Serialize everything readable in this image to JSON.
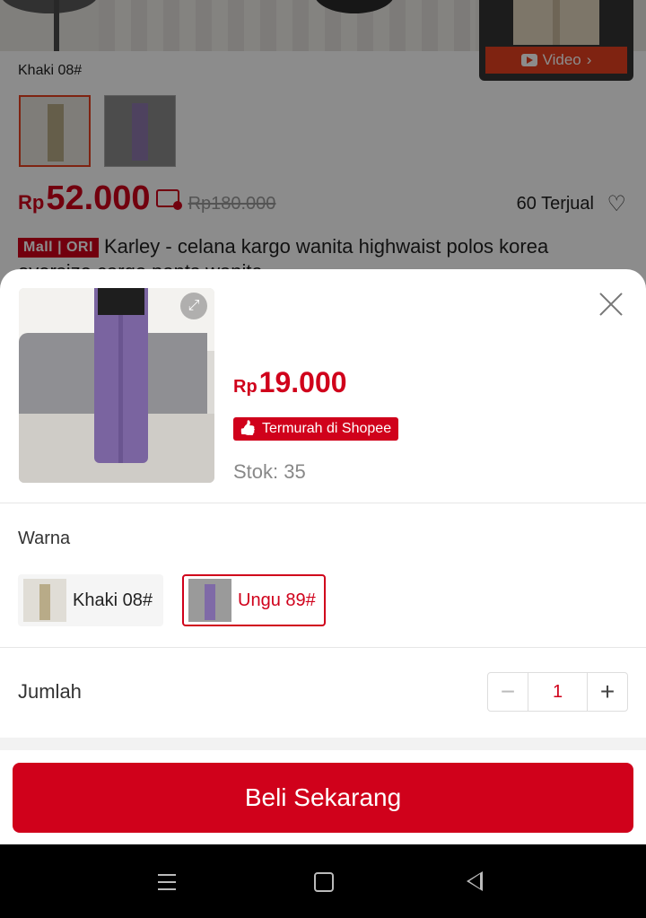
{
  "background": {
    "video_label": "Video",
    "variant_caption": "Khaki 08#",
    "price_currency": "Rp",
    "price": "52.000",
    "original_price": "Rp180.000",
    "sold": "60 Terjual",
    "mall_badge": "Mall | ORI",
    "title": "Karley - celana kargo wanita highwaist polos korea",
    "title_line2": "oversize cargo pants wanita"
  },
  "sheet": {
    "price_currency": "Rp",
    "price": "19.000",
    "badge": "Termurah di Shopee",
    "stock": "Stok: 35",
    "color_label": "Warna",
    "options": [
      {
        "label": "Khaki 08#",
        "selected": false
      },
      {
        "label": "Ungu 89#",
        "selected": true
      }
    ],
    "quantity_label": "Jumlah",
    "quantity": "1",
    "minus": "−",
    "plus": "+",
    "buy_button": "Beli Sekarang"
  },
  "colors": {
    "brand_red": "#d0011b",
    "orange": "#e8411f"
  },
  "icons": {
    "expand": "expand-icon",
    "close": "close-icon",
    "heart": "heart-icon",
    "nav": [
      "menu-icon",
      "home-icon",
      "back-icon"
    ]
  }
}
